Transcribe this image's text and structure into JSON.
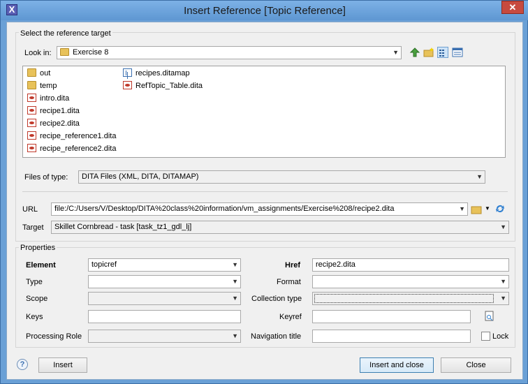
{
  "window": {
    "title": "Insert Reference [Topic Reference]",
    "app_icon_glyph": "X",
    "close_glyph": "✕"
  },
  "reference_target": {
    "group_label": "Select the reference target",
    "look_in_label": "Look in:",
    "look_in_value": "Exercise 8",
    "files": [
      {
        "name": "out",
        "icon": "folder-icon"
      },
      {
        "name": "temp",
        "icon": "folder-icon"
      },
      {
        "name": "intro.dita",
        "icon": "dita-file-icon"
      },
      {
        "name": "recipe1.dita",
        "icon": "dita-file-icon"
      },
      {
        "name": "recipe2.dita",
        "icon": "dita-file-icon"
      },
      {
        "name": "recipe_reference1.dita",
        "icon": "dita-file-icon"
      },
      {
        "name": "recipe_reference2.dita",
        "icon": "dita-file-icon"
      },
      {
        "name": "recipes.ditamap",
        "icon": "ditamap-file-icon"
      },
      {
        "name": "RefTopic_Table.dita",
        "icon": "dita-file-icon"
      }
    ],
    "files_of_type_label": "Files of type:",
    "files_of_type_value": "DITA Files (XML, DITA, DITAMAP)",
    "url_label": "URL",
    "url_value": "file:/C:/Users/V/Desktop/DITA%20class%20information/vm_assignments/Exercise%208/recipe2.dita",
    "target_label": "Target",
    "target_value": "Skillet Cornbread - task [task_tz1_gdl_lj]"
  },
  "properties": {
    "group_label": "Properties",
    "element_label": "Element",
    "element_value": "topicref",
    "href_label": "Href",
    "href_value": "recipe2.dita",
    "type_label": "Type",
    "format_label": "Format",
    "scope_label": "Scope",
    "collection_type_label": "Collection type",
    "keys_label": "Keys",
    "keyref_label": "Keyref",
    "processing_role_label": "Processing Role",
    "navigation_title_label": "Navigation title",
    "lock_label": "Lock"
  },
  "buttons": {
    "insert": "Insert",
    "insert_and_close": "Insert and close",
    "close": "Close",
    "help_glyph": "?"
  },
  "colors": {
    "titlebar": "#6aa0d6",
    "close": "#c74a3f",
    "dialog": "#f0f0f0"
  }
}
